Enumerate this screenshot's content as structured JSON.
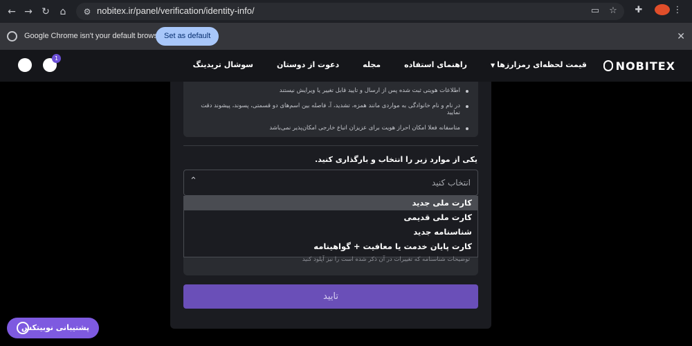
{
  "browser": {
    "url": "nobitex.ir/panel/verification/identity-info/",
    "infobar_text": "Google Chrome isn't your default browser",
    "infobar_button": "Set as default",
    "icons": [
      "back-icon",
      "forward-icon",
      "reload-icon",
      "home-icon",
      "site-settings-icon",
      "cast-icon",
      "star-icon",
      "extensions-icon",
      "profile-icon",
      "menu-dots-icon",
      "close-icon"
    ]
  },
  "header": {
    "logo": "NOBITEX",
    "menu": [
      "قیمت لحظه‌ای رمزارزها",
      "راهنمای استفاده",
      "مجله",
      "دعوت از دوستان",
      "سوشال تریدینگ"
    ],
    "notification_count": "1"
  },
  "notice": {
    "items": [
      "اطلاعات هویتی ثبت شده پس از ارسال و تایید قابل تغییر یا ویرایش نیستند",
      "در نام و نام خانوادگی به مواردی مانند همزه، تشدید، آ، فاصله بین اسم‌های دو قسمتی، پسوند، پیشوند دقت نمایید",
      "متاسفانه فعلا امکان احراز هویت برای عزیزان اتباع خارجی امکان‌پذیر نمی‌باشد"
    ]
  },
  "form": {
    "select_label": "یکی از موارد زیر را انتخاب و بارگذاری کنید.",
    "select_placeholder": "انتخاب کنید",
    "options": [
      "کارت ملی جدید",
      "کارت ملی قدیمی",
      "شناسنامه جدید",
      "کارت پایان خدمت یا معافیت + گواهینامه"
    ],
    "selected_index": 0,
    "hint": "توضیحات شناسنامه که تغییرات در آن ذکر شده است را نیز آپلود کنید",
    "confirm": "تایید"
  },
  "support": {
    "label": "پشتیبانی نوبیتکس"
  },
  "colors": {
    "accent": "#6a4fb8",
    "support": "#7e5ae0",
    "infobar_button": "#a8c7fa"
  }
}
